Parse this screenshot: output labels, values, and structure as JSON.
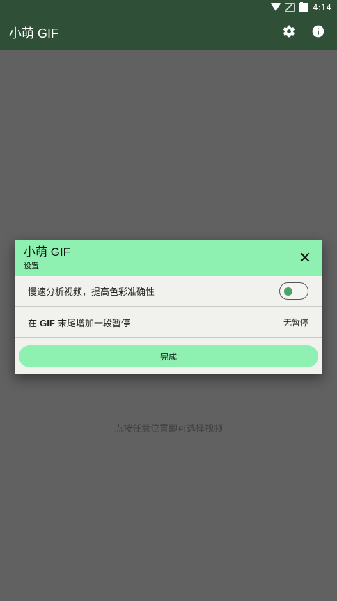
{
  "status_bar": {
    "time": "4:14"
  },
  "app_bar": {
    "title": "小萌 GIF",
    "actions": [
      {
        "icon": "gear-icon"
      },
      {
        "icon": "info-icon"
      }
    ]
  },
  "background_hint": "点按任意位置即可选择视频",
  "dialog": {
    "title": "小萌 GIF",
    "subtitle": "设置",
    "close_icon": "close-icon",
    "settings": [
      {
        "label": "慢速分析视频，提高色彩准确性",
        "control": "toggle",
        "on": true
      },
      {
        "label_prefix": "在 ",
        "label_bold": "GIF",
        "label_suffix": " 末尾增加一段暂停",
        "value": "无暂停"
      }
    ],
    "done_label": "完成"
  },
  "colors": {
    "app_bar": "#2f4f37",
    "accent": "#8ef0b1",
    "toggle_knob": "#4aa46b",
    "scrim": "#616161",
    "dialog_bg": "#f1f1ee"
  }
}
